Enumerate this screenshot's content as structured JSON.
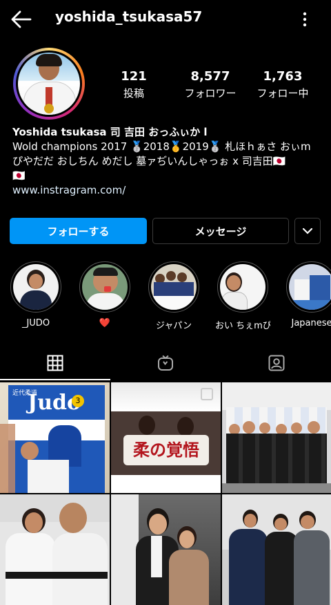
{
  "header": {
    "username": "yoshida_tsukasa57"
  },
  "stats": [
    {
      "value": "121",
      "label": "投稿"
    },
    {
      "value": "8,577",
      "label": "フォロワー"
    },
    {
      "value": "1,763",
      "label": "フォロー中"
    }
  ],
  "bio": {
    "name": "Yoshida tsukasa 司 吉田 おっふぃか l",
    "line1": "Wold champions 2017 🥈2018🥇2019🥈 札ほｈぁさ おぃm",
    "line2": "ぴやだだ おしちん めだし 墓ァぢいんしゃっぉ x 司吉田🇯🇵",
    "line3": "🇯🇵",
    "link": "www.instragram.com/"
  },
  "buttons": {
    "follow": "フォローする",
    "message": "メッセージ"
  },
  "highlights": [
    {
      "label": "_JUDO"
    },
    {
      "label": "❤️"
    },
    {
      "label": "ジャパン"
    },
    {
      "label": "おい ちぇmぴ…"
    },
    {
      "label": "Japanese"
    }
  ],
  "posts": {
    "p1": {
      "magazine": "近代柔道",
      "title": "Judo",
      "issue": "3"
    },
    "p2": {
      "caption": "柔の覚悟"
    }
  },
  "icons": {
    "back": "arrow-left-icon",
    "menu": "more-vertical-icon",
    "grid": "grid-icon",
    "igtv": "igtv-icon",
    "tagged": "tagged-user-icon",
    "more": "chevron-down-icon"
  }
}
